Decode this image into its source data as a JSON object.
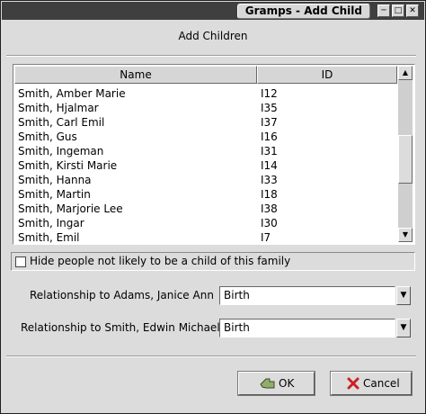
{
  "window": {
    "title": "Gramps - Add Child",
    "header": "Add Children"
  },
  "columns": {
    "name": "Name",
    "id": "ID"
  },
  "rows": [
    {
      "name": "Smith, Amber Marie",
      "id": "I12"
    },
    {
      "name": "Smith, Hjalmar",
      "id": "I35"
    },
    {
      "name": "Smith, Carl Emil",
      "id": "I37"
    },
    {
      "name": "Smith, Gus",
      "id": "I16"
    },
    {
      "name": "Smith, Ingeman",
      "id": "I31"
    },
    {
      "name": "Smith, Kirsti Marie",
      "id": "I14"
    },
    {
      "name": "Smith, Hanna",
      "id": "I33"
    },
    {
      "name": "Smith, Martin",
      "id": "I18"
    },
    {
      "name": "Smith, Marjorie Lee",
      "id": "I38"
    },
    {
      "name": "Smith, Ingar",
      "id": "I30"
    },
    {
      "name": "Smith, Emil",
      "id": "I7"
    }
  ],
  "filter": {
    "label": "Hide people not likely to be a child of this family",
    "checked": false
  },
  "relationships": [
    {
      "label": "Relationship to Adams, Janice Ann",
      "value": "Birth"
    },
    {
      "label": "Relationship to Smith, Edwin Michael",
      "value": "Birth"
    }
  ],
  "buttons": {
    "ok": "OK",
    "cancel": "Cancel"
  },
  "icons": {
    "minimize": "minimize-icon",
    "maximize": "maximize-icon",
    "close": "close-icon",
    "ok": "ok-hand-icon",
    "cancel": "red-x-icon"
  },
  "colors": {
    "titlebar": "#3f3f3f",
    "dialog": "#dcdcdc",
    "cancel_icon": "#cc2020"
  }
}
